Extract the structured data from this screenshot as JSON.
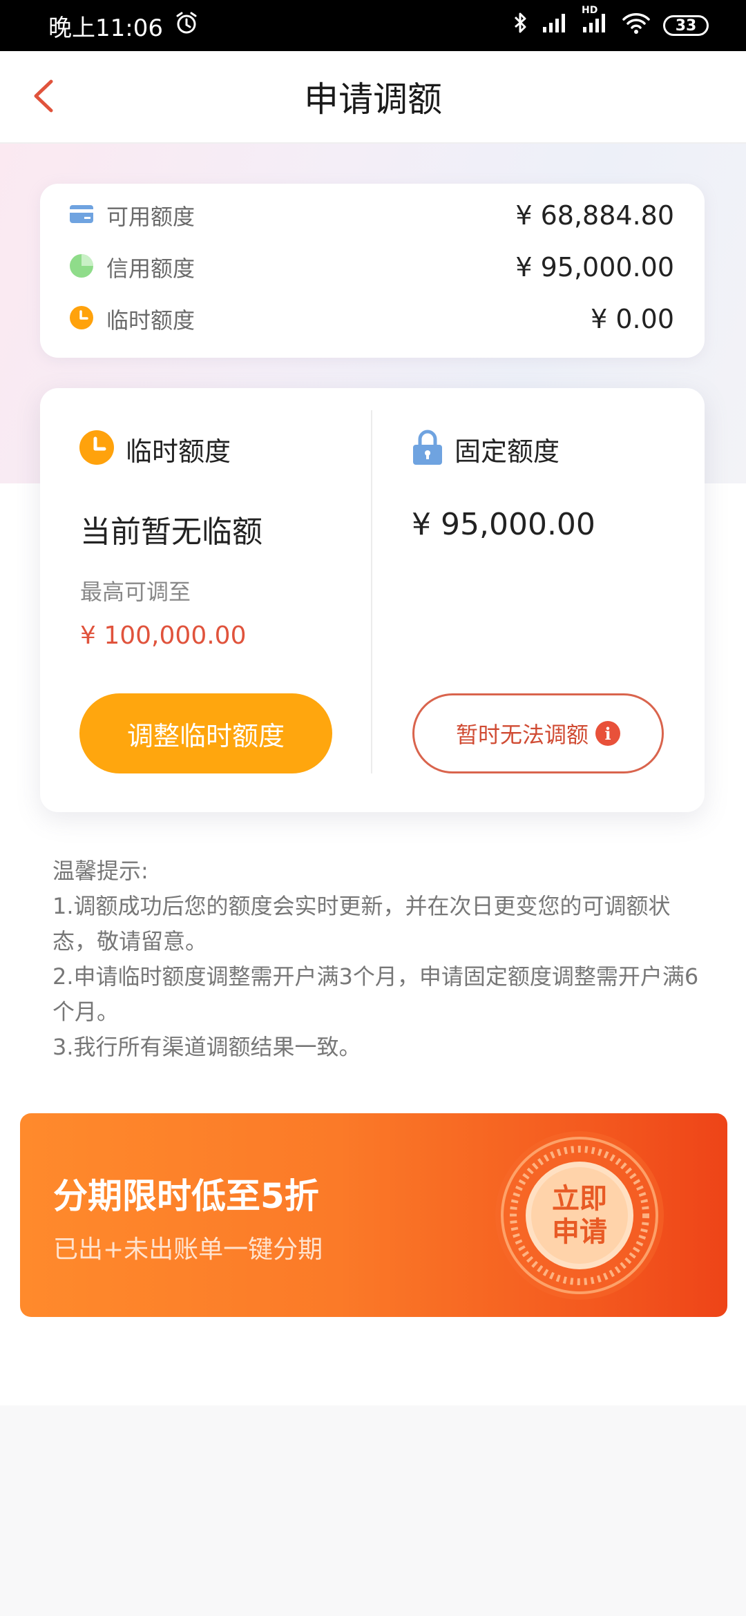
{
  "status_bar": {
    "time": "晚上11:06",
    "network": "HD",
    "battery": "33"
  },
  "nav": {
    "title": "申请调额"
  },
  "summary": {
    "rows": [
      {
        "label": "可用额度",
        "value": "¥ 68,884.80",
        "icon": "card-icon"
      },
      {
        "label": "信用额度",
        "value": "¥ 95,000.00",
        "icon": "pie-icon"
      },
      {
        "label": "临时额度",
        "value": "¥ 0.00",
        "icon": "clock-icon"
      }
    ]
  },
  "temp_quota": {
    "heading": "临时额度",
    "status": "当前暂无临额",
    "max_label": "最高可调至",
    "max_value": "¥ 100,000.00",
    "button": "调整临时额度"
  },
  "fixed_quota": {
    "heading": "固定额度",
    "value": "¥ 95,000.00",
    "button": "暂时无法调额"
  },
  "tips": {
    "title": "温馨提示:",
    "lines": [
      "1.调额成功后您的额度会实时更新，并在次日更变您的可调额状态，敬请留意。",
      "2.申请临时额度调整需开户满3个月，申请固定额度调整需开户满6个月。",
      "3.我行所有渠道调额结果一致。"
    ]
  },
  "banner": {
    "title": "分期限时低至5折",
    "subtitle": "已出+未出账单一键分期",
    "cta_line1": "立即",
    "cta_line2": "申请"
  },
  "colors": {
    "accent_orange": "#ffa60e",
    "accent_red": "#e0533c",
    "back_arrow": "#e0533c"
  }
}
